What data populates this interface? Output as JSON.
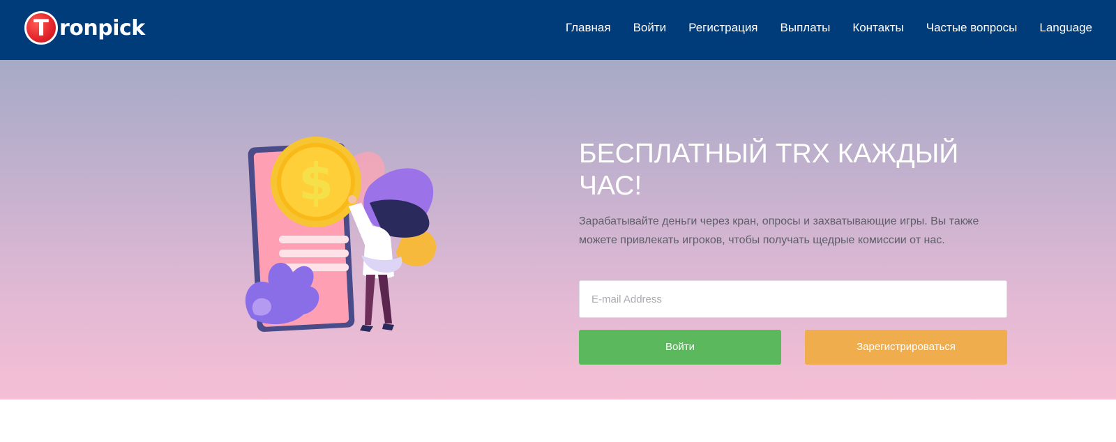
{
  "brand": {
    "logo_letter": "T",
    "logo_text": "ronpick"
  },
  "nav": {
    "items": [
      {
        "label": "Главная"
      },
      {
        "label": "Войти"
      },
      {
        "label": "Регистрация"
      },
      {
        "label": "Выплаты"
      },
      {
        "label": "Контакты"
      },
      {
        "label": "Частые вопросы"
      },
      {
        "label": "Language"
      }
    ]
  },
  "hero": {
    "title": "БЕСПЛАТНЫЙ TRX КАЖДЫЙ ЧАС!",
    "description": "Зарабатывайте деньги через кран, опросы и захватывающие игры. Вы также можете привлекать игроков, чтобы получать щедрые комиссии от нас.",
    "email_placeholder": "E-mail Address",
    "email_value": "",
    "login_label": "Войти",
    "register_label": "Зарегистрироваться",
    "coin_symbol": "$"
  },
  "colors": {
    "navbar": "#003c79",
    "login_button": "#5cb85c",
    "register_button": "#f0ad4e",
    "logo_red": "#e2232a"
  }
}
